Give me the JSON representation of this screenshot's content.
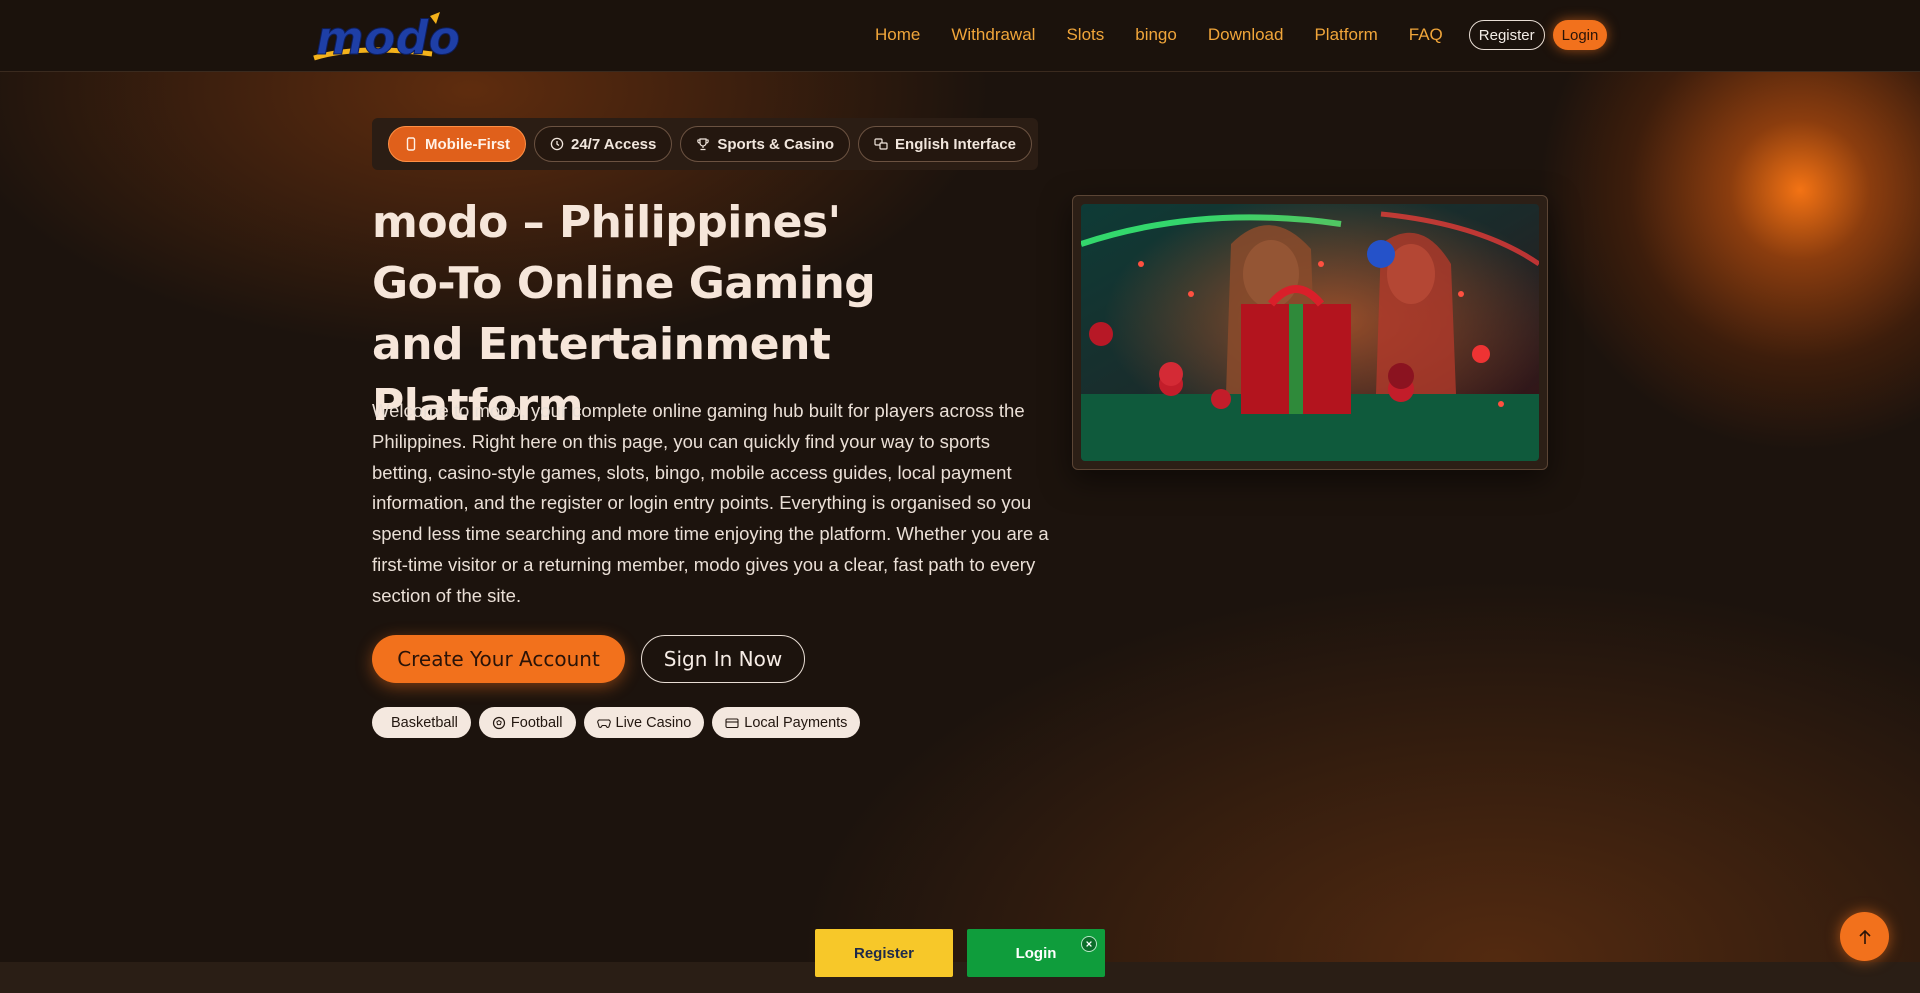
{
  "header": {
    "logo_text": "modo",
    "nav": [
      "Home",
      "Withdrawal",
      "Slots",
      "bingo",
      "Download",
      "Platform",
      "FAQ"
    ],
    "register_label": "Register",
    "login_label": "Login"
  },
  "features": [
    {
      "label": "Mobile-First",
      "icon": "phone-icon"
    },
    {
      "label": "24/7 Access",
      "icon": "clock-icon"
    },
    {
      "label": "Sports & Casino",
      "icon": "trophy-icon"
    },
    {
      "label": "English Interface",
      "icon": "translate-icon"
    }
  ],
  "hero": {
    "title": "modo – Philippines' Go-To Online Gaming and Entertainment Platform",
    "description": "Welcome to modo, your complete online gaming hub built for players across the Philippines. Right here on this page, you can quickly find your way to sports betting, casino-style games, slots, bingo, mobile access guides, local payment information, and the register or login entry points. Everything is organised so you spend less time searching and more time enjoying the platform. Whether you are a first-time visitor or a returning member, modo gives you a clear, fast path to every section of the site.",
    "cta_primary": "Create Your Account",
    "cta_secondary": "Sign In Now",
    "tags": [
      {
        "label": "Basketball",
        "icon": ""
      },
      {
        "label": "Football",
        "icon": "football-icon"
      },
      {
        "label": "Live Casino",
        "icon": "gamepad-icon"
      },
      {
        "label": "Local Payments",
        "icon": "card-icon"
      }
    ]
  },
  "floating": {
    "register_label": "Register",
    "login_label": "Login"
  },
  "colors": {
    "accent": "#f2711c",
    "nav_link": "#f0a53a",
    "background": "#1c130d",
    "float_register": "#f7c829",
    "float_login": "#0f9d3c"
  }
}
